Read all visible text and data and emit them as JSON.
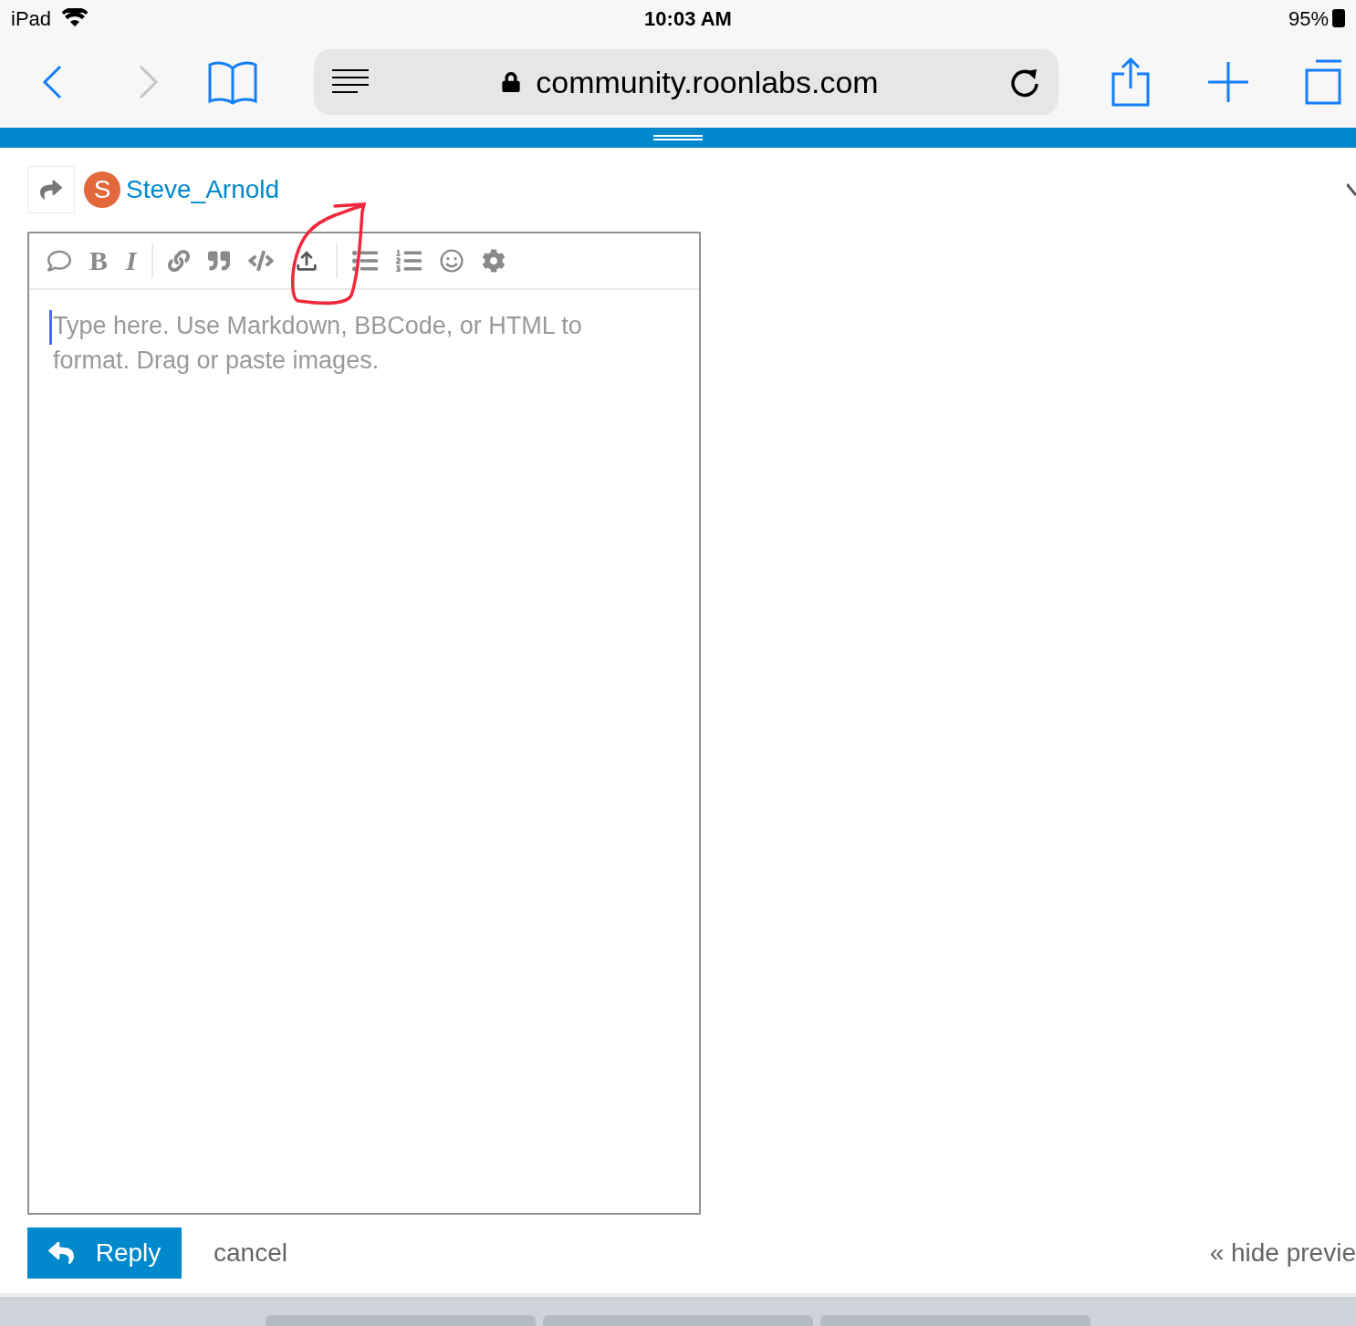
{
  "status_bar": {
    "device": "iPad",
    "time": "10:03 AM",
    "battery": "95%"
  },
  "browser": {
    "url": "community.roonlabs.com",
    "back_enabled": true,
    "forward_enabled": false
  },
  "composer": {
    "user": {
      "initial": "S",
      "name": "Steve_Arnold",
      "color": "#e2673b"
    },
    "toolbar": [
      [
        {
          "kind": "bubble"
        },
        {
          "kind": "bold",
          "label": "B"
        },
        {
          "kind": "italic",
          "label": "I"
        }
      ],
      [
        {
          "kind": "link"
        },
        {
          "kind": "quote"
        },
        {
          "kind": "code"
        },
        {
          "kind": "upload"
        }
      ],
      [
        {
          "kind": "bullets"
        },
        {
          "kind": "numbers"
        },
        {
          "kind": "emoji"
        },
        {
          "kind": "gear"
        }
      ]
    ],
    "placeholder": "Type here. Use Markdown, BBCode, or HTML to format. Drag or paste images.",
    "reply_button": "Reply",
    "cancel": "cancel",
    "hide_preview": "« hide previe"
  }
}
